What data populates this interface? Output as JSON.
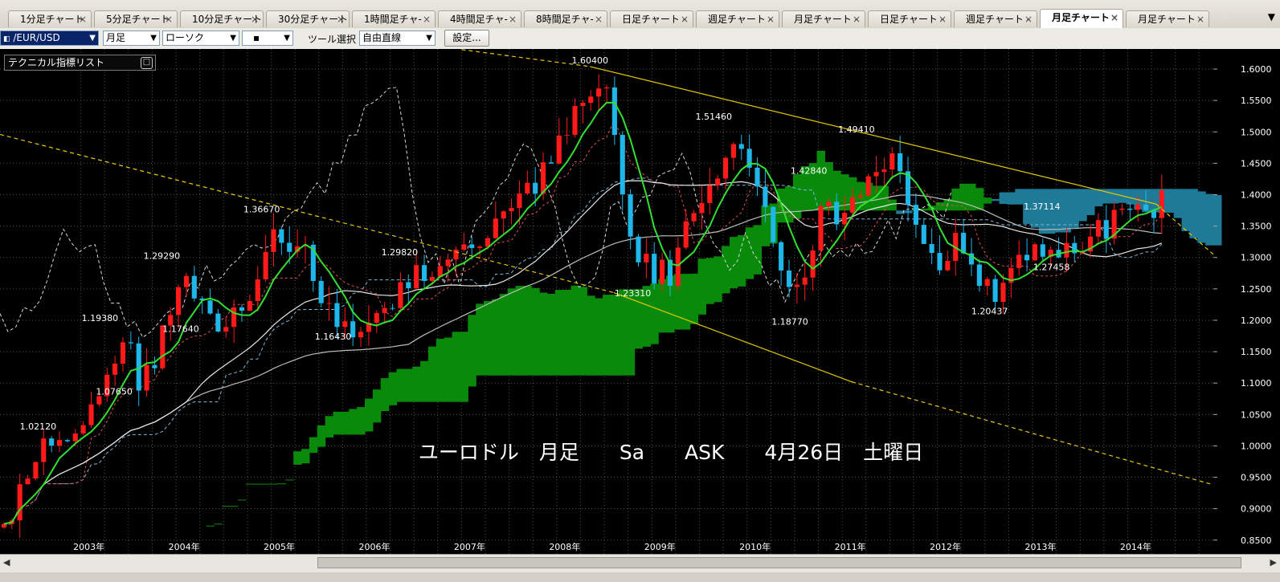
{
  "tabs": [
    {
      "label": "1分足チャート"
    },
    {
      "label": "5分足チャート"
    },
    {
      "label": "10分足チャート"
    },
    {
      "label": "30分足チャート"
    },
    {
      "label": "1時間足チャ-"
    },
    {
      "label": "4時間足チャ-"
    },
    {
      "label": "8時間足チャ-"
    },
    {
      "label": "日足チャート -"
    },
    {
      "label": "週足チャート -"
    },
    {
      "label": "月足チャート -"
    },
    {
      "label": "日足チャート -"
    },
    {
      "label": "週足チャート -"
    },
    {
      "label": "月足チャート ·"
    },
    {
      "label": "月足チャート -"
    }
  ],
  "active_tab": 12,
  "tab_close": "×",
  "tab_menu": "▼",
  "toolbar": {
    "symbol": "/EUR/USD",
    "timeframe": "月足",
    "chart_style": "ローソク",
    "line_style": "▪",
    "tool_label": "ツール選択",
    "tool_value": "自由直線",
    "settings_label": "設定..."
  },
  "indicator_panel": {
    "label": "テクニカル指標リスト",
    "toggle": "□"
  },
  "colors": {
    "background": "#000000",
    "up_candle": "#ff1a1a",
    "down_candle": "#1fb6ea",
    "kumo_bull": "#0a8a0a",
    "kumo_bear": "#1e7a96",
    "ma_fast": "#32e032",
    "trendline": "#e6c800",
    "grid": "#505050"
  },
  "chart_data": {
    "type": "candlestick",
    "title": "ユーロドル　月足　　Sa　　ASK　　4月26日　土曜日",
    "y_ticks": [
      "1.6000",
      "1.5500",
      "1.5000",
      "1.4500",
      "1.4000",
      "1.3500",
      "1.3000",
      "1.2500",
      "1.2000",
      "1.1500",
      "1.1000",
      "1.0500",
      "1.0000",
      "0.9500",
      "0.9000",
      "0.8500"
    ],
    "ylim": [
      0.828,
      1.632
    ],
    "x_ticks": [
      {
        "label": "2003年",
        "t": 2003.0
      },
      {
        "label": "2004年",
        "t": 2004.0
      },
      {
        "label": "2005年",
        "t": 2005.0
      },
      {
        "label": "2006年",
        "t": 2006.0
      },
      {
        "label": "2007年",
        "t": 2007.0
      },
      {
        "label": "2008年",
        "t": 2008.0
      },
      {
        "label": "2009年",
        "t": 2009.0
      },
      {
        "label": "2010年",
        "t": 2010.0
      },
      {
        "label": "2011年",
        "t": 2011.0
      },
      {
        "label": "2012年",
        "t": 2012.0
      },
      {
        "label": "2013年",
        "t": 2013.0
      },
      {
        "label": "2014年",
        "t": 2014.0
      }
    ],
    "xlim": [
      2002.15,
      2014.9
    ],
    "price_anchors": [
      [
        2002.15,
        0.87
      ],
      [
        2002.45,
        0.985
      ],
      [
        2002.55,
        1.012
      ],
      [
        2002.75,
        0.985
      ],
      [
        2003.0,
        1.045
      ],
      [
        2003.3,
        1.135
      ],
      [
        2003.45,
        1.17
      ],
      [
        2003.55,
        1.095
      ],
      [
        2003.7,
        1.13
      ],
      [
        2003.85,
        1.2
      ],
      [
        2004.05,
        1.262
      ],
      [
        2004.15,
        1.235
      ],
      [
        2004.35,
        1.198
      ],
      [
        2004.6,
        1.215
      ],
      [
        2004.85,
        1.285
      ],
      [
        2004.98,
        1.345
      ],
      [
        2005.15,
        1.31
      ],
      [
        2005.35,
        1.3
      ],
      [
        2005.55,
        1.215
      ],
      [
        2005.8,
        1.19
      ],
      [
        2005.95,
        1.18
      ],
      [
        2006.1,
        1.205
      ],
      [
        2006.35,
        1.268
      ],
      [
        2006.6,
        1.275
      ],
      [
        2006.8,
        1.3
      ],
      [
        2006.95,
        1.32
      ],
      [
        2007.2,
        1.335
      ],
      [
        2007.45,
        1.365
      ],
      [
        2007.7,
        1.415
      ],
      [
        2007.95,
        1.468
      ],
      [
        2008.2,
        1.56
      ],
      [
        2008.35,
        1.57
      ],
      [
        2008.5,
        1.565
      ],
      [
        2008.6,
        1.47
      ],
      [
        2008.75,
        1.3
      ],
      [
        2008.95,
        1.28
      ],
      [
        2009.15,
        1.275
      ],
      [
        2009.4,
        1.385
      ],
      [
        2009.6,
        1.42
      ],
      [
        2009.85,
        1.485
      ],
      [
        2009.95,
        1.44
      ],
      [
        2010.2,
        1.36
      ],
      [
        2010.35,
        1.27
      ],
      [
        2010.45,
        1.225
      ],
      [
        2010.6,
        1.3
      ],
      [
        2010.8,
        1.395
      ],
      [
        2010.95,
        1.35
      ],
      [
        2011.15,
        1.4
      ],
      [
        2011.3,
        1.44
      ],
      [
        2011.5,
        1.445
      ],
      [
        2011.65,
        1.385
      ],
      [
        2011.8,
        1.34
      ],
      [
        2011.95,
        1.295
      ],
      [
        2012.15,
        1.325
      ],
      [
        2012.35,
        1.262
      ],
      [
        2012.55,
        1.24
      ],
      [
        2012.8,
        1.3
      ],
      [
        2012.95,
        1.32
      ],
      [
        2013.15,
        1.3
      ],
      [
        2013.35,
        1.31
      ],
      [
        2013.55,
        1.33
      ],
      [
        2013.8,
        1.36
      ],
      [
        2013.95,
        1.378
      ],
      [
        2014.1,
        1.375
      ],
      [
        2014.28,
        1.385
      ]
    ],
    "candles_visible": "monthly, 2002-2014",
    "annotations": [
      {
        "text": "1.60400",
        "t": 2008.35,
        "v": 1.604
      },
      {
        "text": "1.51460",
        "t": 2009.65,
        "v": 1.5146
      },
      {
        "text": "1.49410",
        "t": 2011.15,
        "v": 1.4941
      },
      {
        "text": "1.42840",
        "t": 2010.65,
        "v": 1.4284
      },
      {
        "text": "1.37114",
        "t": 2013.1,
        "v": 1.3711
      },
      {
        "text": "1.36670",
        "t": 2004.9,
        "v": 1.3667
      },
      {
        "text": "1.29820",
        "t": 2006.35,
        "v": 1.2982
      },
      {
        "text": "1.29290",
        "t": 2003.85,
        "v": 1.2929
      },
      {
        "text": "1.19380",
        "t": 2003.2,
        "v": 1.1938
      },
      {
        "text": "1.17640",
        "t": 2004.05,
        "v": 1.1764
      },
      {
        "text": "1.16430",
        "t": 2005.65,
        "v": 1.1643
      },
      {
        "text": "1.07650",
        "t": 2003.35,
        "v": 1.0765
      },
      {
        "text": "1.02120",
        "t": 2002.55,
        "v": 1.0212
      },
      {
        "text": "1.23310",
        "t": 2008.8,
        "v": 1.2331
      },
      {
        "text": "1.18770",
        "t": 2010.45,
        "v": 1.1877
      },
      {
        "text": "1.27458",
        "t": 2013.2,
        "v": 1.2746
      },
      {
        "text": "1.20437",
        "t": 2012.55,
        "v": 1.2044
      }
    ],
    "trendlines": [
      {
        "style": "solid",
        "points": [
          [
            2008.35,
            1.604
          ],
          [
            2014.3,
            1.385
          ]
        ]
      },
      {
        "style": "dashed",
        "points": [
          [
            2014.3,
            1.385
          ],
          [
            2014.9,
            1.305
          ]
        ]
      },
      {
        "style": "dashed",
        "points": [
          [
            2002.15,
            1.496
          ],
          [
            2008.6,
            1.244
          ]
        ]
      },
      {
        "style": "solid",
        "points": [
          [
            2008.6,
            1.244
          ],
          [
            2011.1,
            1.102
          ]
        ]
      },
      {
        "style": "dashed",
        "points": [
          [
            2011.1,
            1.102
          ],
          [
            2014.9,
            0.938
          ]
        ]
      },
      {
        "style": "dashed",
        "points": [
          [
            2007.0,
            1.631
          ],
          [
            2008.35,
            1.604
          ]
        ]
      }
    ]
  }
}
